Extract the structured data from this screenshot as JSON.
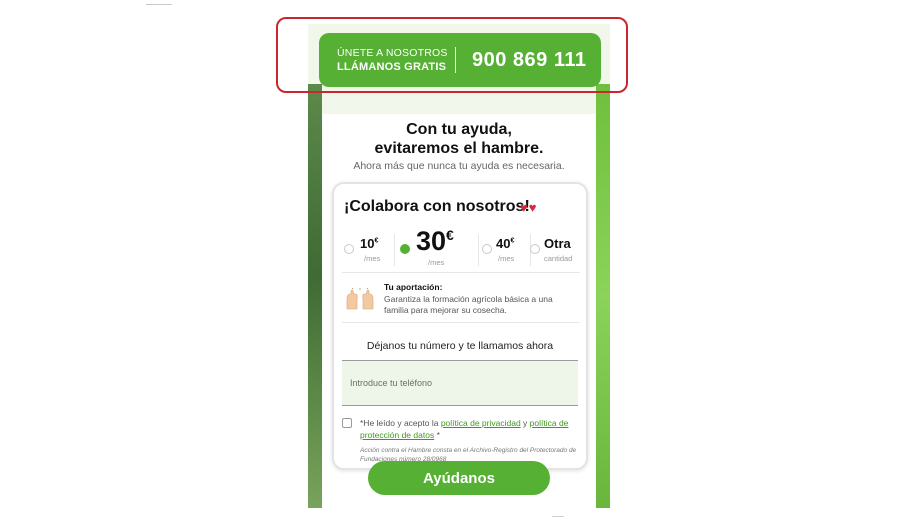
{
  "banner": {
    "line1": "ÚNETE A NOSOTROS",
    "line2": "LLÁMANOS GRATIS",
    "phone": "900 869 111"
  },
  "hero": {
    "headline_line1": "Con tu ayuda,",
    "headline_line2": "evitaremos el hambre.",
    "subtitle": "Ahora más que nunca tu ayuda es necesaria."
  },
  "card": {
    "title": "¡Colabora con nosotros!",
    "hearts": "♥♥",
    "amounts": [
      {
        "value": "10",
        "currency": "€",
        "unit": "/mes",
        "selected": false
      },
      {
        "value": "30",
        "currency": "€",
        "unit": "/mes",
        "selected": true
      },
      {
        "value": "40",
        "currency": "€",
        "unit": "/mes",
        "selected": false
      },
      {
        "value": "Otra",
        "currency": "",
        "unit": "cantidad",
        "selected": false
      }
    ],
    "contribution_title": "Tu aportación:",
    "contribution_text": "Garantiza la formación agrícola básica a una familia para mejorar su cosecha.",
    "phone_prompt": "Déjanos tu número y te llamamos ahora",
    "phone_placeholder": "Introduce tu teléfono",
    "consent_prefix": "*He leído y acepto la ",
    "privacy_link": "política de privacidad",
    "consent_and": " y ",
    "data_link": " política de protección de datos",
    "consent_suffix": " *",
    "legal_note": "Acción contra el Hambre consta en el Archivo-Registro del Protectorado de Fundaciones número 28/0968"
  },
  "cta": {
    "label": "Ayúdanos"
  },
  "colors": {
    "brand_green": "#55b033",
    "highlight_red": "#c8282d"
  }
}
